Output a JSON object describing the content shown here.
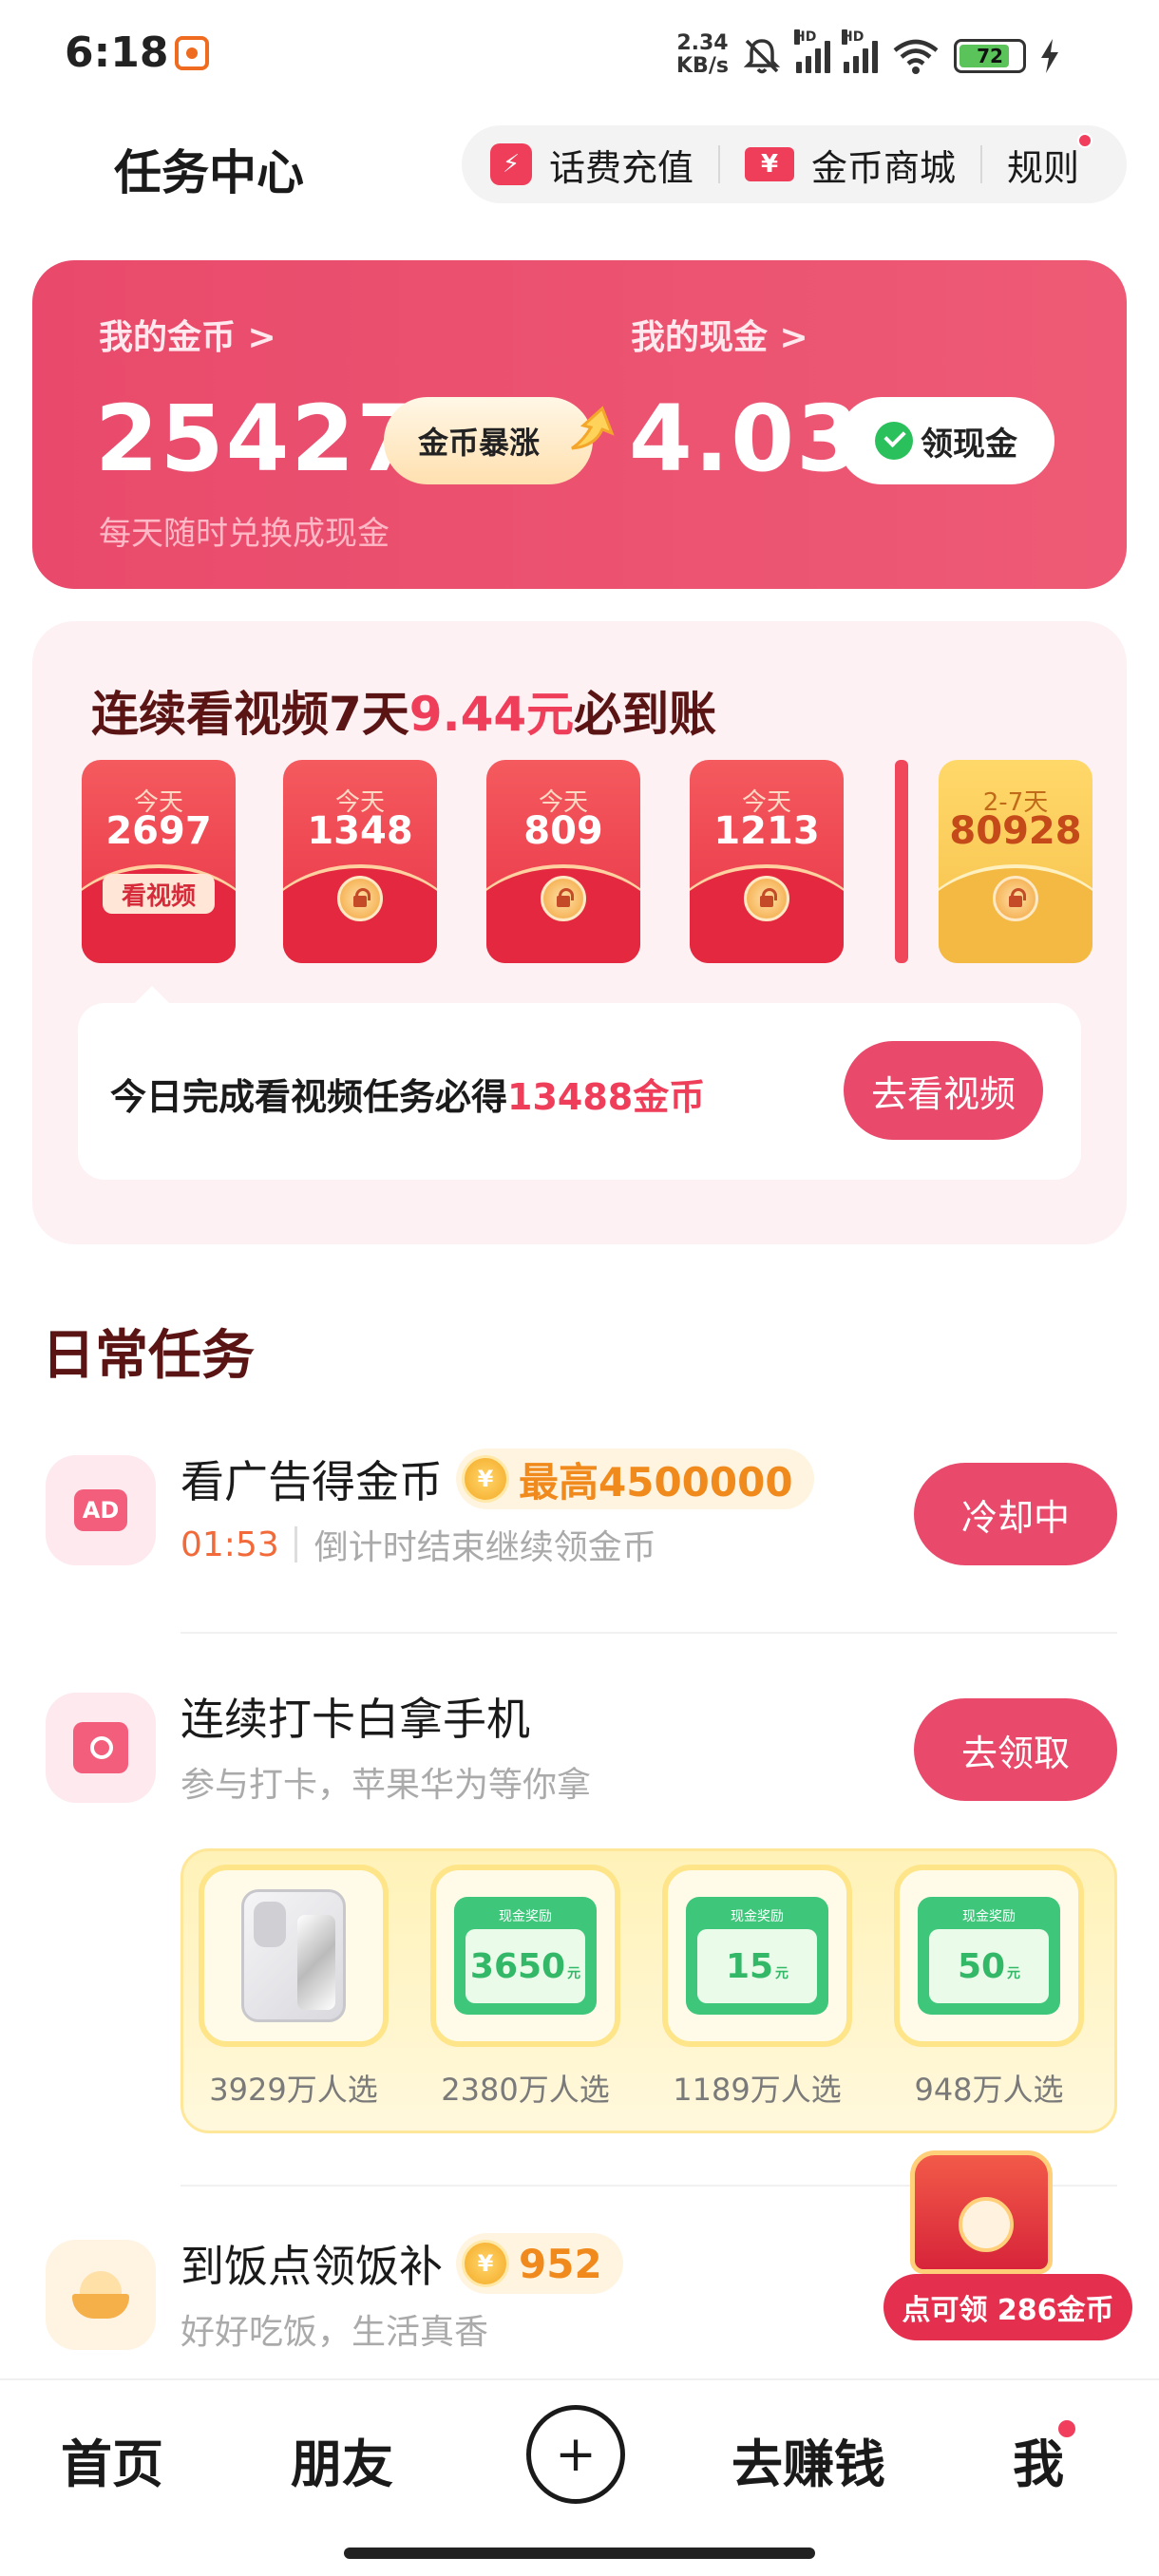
{
  "status_bar": {
    "time": "6:18",
    "net_speed_value": "2.34",
    "net_speed_unit": "KB/s",
    "hd_label": "HD",
    "battery": "72",
    "icons": [
      "app-notification-icon",
      "mute-bell-icon",
      "signal-icon",
      "signal-icon",
      "wifi-icon",
      "battery-icon",
      "charging-icon"
    ]
  },
  "header": {
    "title": "任务中心",
    "recharge_label": "话费充值",
    "recharge_icon": "⚡",
    "mall_label": "金币商城",
    "mall_icon": "¥",
    "rules_label": "规则"
  },
  "wallet": {
    "coins_label": "我的金币 >",
    "coins_value": "25427",
    "boost_label": "金币暴涨",
    "cash_label": "我的现金 >",
    "cash_value": "4.03",
    "claim_cash_label": "领现金",
    "subtext": "每天随时兑换成现金"
  },
  "streak": {
    "title_prefix": "连续看视频7天",
    "title_amount": "9.44元",
    "title_suffix": "必到账",
    "packets": [
      {
        "day": "今天",
        "value": "2697",
        "tag": "看视频"
      },
      {
        "day": "今天",
        "value": "1348"
      },
      {
        "day": "今天",
        "value": "809"
      },
      {
        "day": "今天",
        "value": "1213"
      },
      {
        "day": "2-7天",
        "value": "80928"
      }
    ],
    "task_text_prefix": "今日完成看视频任务必得",
    "task_text_amount": "13488金币",
    "go_button": "去看视频"
  },
  "daily": {
    "section_title": "日常任务",
    "tasks": [
      {
        "icon": "ad-icon",
        "icon_text": "AD",
        "name": "看广告得金币",
        "badge": "最高4500000",
        "timer": "01:53",
        "sub": "倒计时结束继续领金币",
        "button": "冷却中"
      },
      {
        "icon": "phone-gift-icon",
        "name": "连续打卡白拿手机",
        "sub": "参与打卡，苹果华为等你拿",
        "button": "去领取"
      },
      {
        "icon": "rice-bowl-icon",
        "name": "到饭点领饭补",
        "badge": "952",
        "sub": "好好吃饭，生活真香"
      }
    ],
    "prizes": [
      {
        "type": "phone",
        "label": "3929万人选"
      },
      {
        "type": "cash",
        "ticket_title": "现金奖励",
        "amount": "3650",
        "unit": "元",
        "label": "2380万人选"
      },
      {
        "type": "cash",
        "ticket_title": "现金奖励",
        "amount": "15",
        "unit": "元",
        "label": "1189万人选"
      },
      {
        "type": "cash",
        "ticket_title": "现金奖励",
        "amount": "50",
        "unit": "元",
        "label": "948万人选"
      }
    ]
  },
  "floating": {
    "coin_symbol": "¥",
    "claim_text": "点可领 286金币"
  },
  "bottom_nav": {
    "home": "首页",
    "friends": "朋友",
    "plus": "+",
    "earn": "去赚钱",
    "me": "我"
  },
  "colors": {
    "accent": "#e94a6b",
    "title_dark": "#5b1414",
    "highlight": "#ef3e5a",
    "coin_orange": "#f08a1c"
  }
}
